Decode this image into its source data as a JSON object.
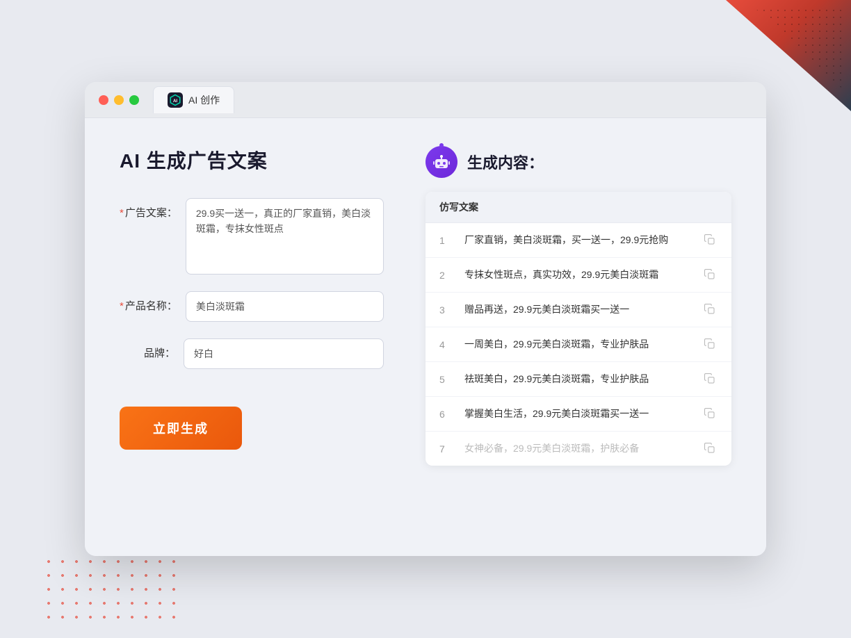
{
  "browser": {
    "tab_label": "AI 创作"
  },
  "page": {
    "title": "AI 生成广告文案",
    "result_title": "生成内容："
  },
  "form": {
    "ad_copy_label": "广告文案：",
    "ad_copy_required": "＊",
    "ad_copy_value": "29.9买一送一，真正的厂家直销，美白淡斑霜，专抹女性斑点",
    "product_name_label": "产品名称：",
    "product_name_required": "＊",
    "product_name_value": "美白淡斑霜",
    "brand_label": "品牌：",
    "brand_value": "好白",
    "generate_button": "立即生成"
  },
  "result": {
    "table_header": "仿写文案",
    "items": [
      {
        "num": "1",
        "text": "厂家直销，美白淡斑霜，买一送一，29.9元抢购",
        "dimmed": false
      },
      {
        "num": "2",
        "text": "专抹女性斑点，真实功效，29.9元美白淡斑霜",
        "dimmed": false
      },
      {
        "num": "3",
        "text": "赠品再送，29.9元美白淡斑霜买一送一",
        "dimmed": false
      },
      {
        "num": "4",
        "text": "一周美白，29.9元美白淡斑霜，专业护肤品",
        "dimmed": false
      },
      {
        "num": "5",
        "text": "祛斑美白，29.9元美白淡斑霜，专业护肤品",
        "dimmed": false
      },
      {
        "num": "6",
        "text": "掌握美白生活，29.9元美白淡斑霜买一送一",
        "dimmed": false
      },
      {
        "num": "7",
        "text": "女神必备，29.9元美白淡斑霜，护肤必备",
        "dimmed": true
      }
    ]
  }
}
